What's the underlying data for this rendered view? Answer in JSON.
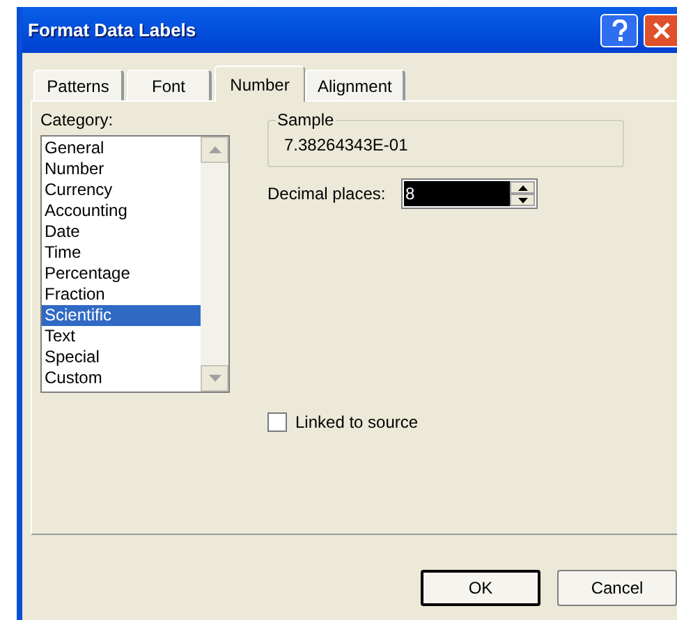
{
  "window": {
    "title": "Format Data Labels"
  },
  "tabs": [
    {
      "label": "Patterns",
      "selected": false
    },
    {
      "label": "Font",
      "selected": false
    },
    {
      "label": "Number",
      "selected": true
    },
    {
      "label": "Alignment",
      "selected": false
    }
  ],
  "category": {
    "label": "Category:",
    "items": [
      {
        "label": "General",
        "selected": false
      },
      {
        "label": "Number",
        "selected": false
      },
      {
        "label": "Currency",
        "selected": false
      },
      {
        "label": "Accounting",
        "selected": false
      },
      {
        "label": "Date",
        "selected": false
      },
      {
        "label": "Time",
        "selected": false
      },
      {
        "label": "Percentage",
        "selected": false
      },
      {
        "label": "Fraction",
        "selected": false
      },
      {
        "label": "Scientific",
        "selected": true
      },
      {
        "label": "Text",
        "selected": false
      },
      {
        "label": "Special",
        "selected": false
      },
      {
        "label": "Custom",
        "selected": false
      }
    ]
  },
  "sample": {
    "label": "Sample",
    "value": "7.38264343E-01"
  },
  "decimal_places": {
    "label": "Decimal places:",
    "value": "8"
  },
  "linked_to_source": {
    "label": "Linked to source",
    "checked": false
  },
  "buttons": [
    {
      "label": "OK",
      "default": true
    },
    {
      "label": "Cancel",
      "default": false
    }
  ]
}
